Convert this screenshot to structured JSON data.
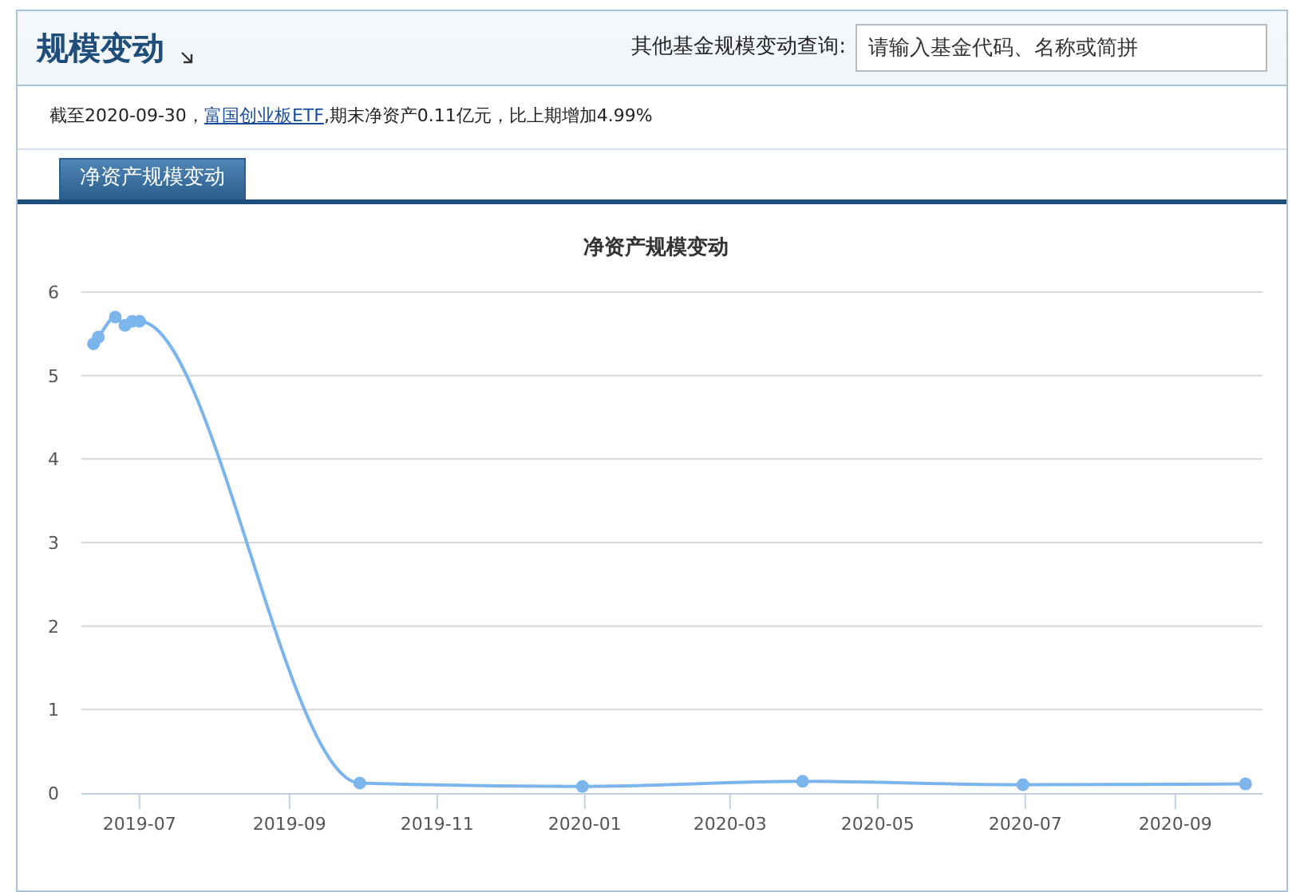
{
  "header": {
    "title": "规模变动",
    "search_label": "其他基金规模变动查询:",
    "search": {
      "placeholder": "请输入基金代码、名称或简拼"
    }
  },
  "summary": {
    "before": "截至2020-09-30，",
    "link": "富国创业板ETF",
    "after": ",期末净资产0.11亿元，比上期增加4.99%"
  },
  "tabs": [
    {
      "label": "净资产规模变动",
      "selected": true
    }
  ],
  "chart": {
    "chart_data": {
      "type": "line",
      "title": "净资产规模变动",
      "x": [
        "2019-06-12",
        "2019-06-14",
        "2019-06-21",
        "2019-06-25",
        "2019-06-28",
        "2019-07-01",
        "2019-09-30",
        "2019-12-31",
        "2020-03-31",
        "2020-06-30",
        "2020-09-30"
      ],
      "series": [
        {
          "color": "#7cb5ec",
          "marker": "circle",
          "values": [
            5.38,
            5.46,
            5.7,
            5.6,
            5.65,
            5.65,
            0.12,
            0.08,
            0.14,
            0.1,
            0.11
          ]
        }
      ],
      "xlim": [
        "2019-06-07",
        "2020-10-07"
      ],
      "ylim": [
        0,
        6
      ],
      "grid": true,
      "yticks": [
        0,
        1,
        2,
        3,
        4,
        5,
        6
      ],
      "xticks": [
        {
          "value": "2019-07-01",
          "label": "2019-07"
        },
        {
          "value": "2019-09-01",
          "label": "2019-09"
        },
        {
          "value": "2019-11-01",
          "label": "2019-11"
        },
        {
          "value": "2020-01-01",
          "label": "2020-01"
        },
        {
          "value": "2020-03-01",
          "label": "2020-03"
        },
        {
          "value": "2020-05-01",
          "label": "2020-05"
        },
        {
          "value": "2020-07-01",
          "label": "2020-07"
        },
        {
          "value": "2020-09-01",
          "label": "2020-09"
        }
      ]
    }
  }
}
